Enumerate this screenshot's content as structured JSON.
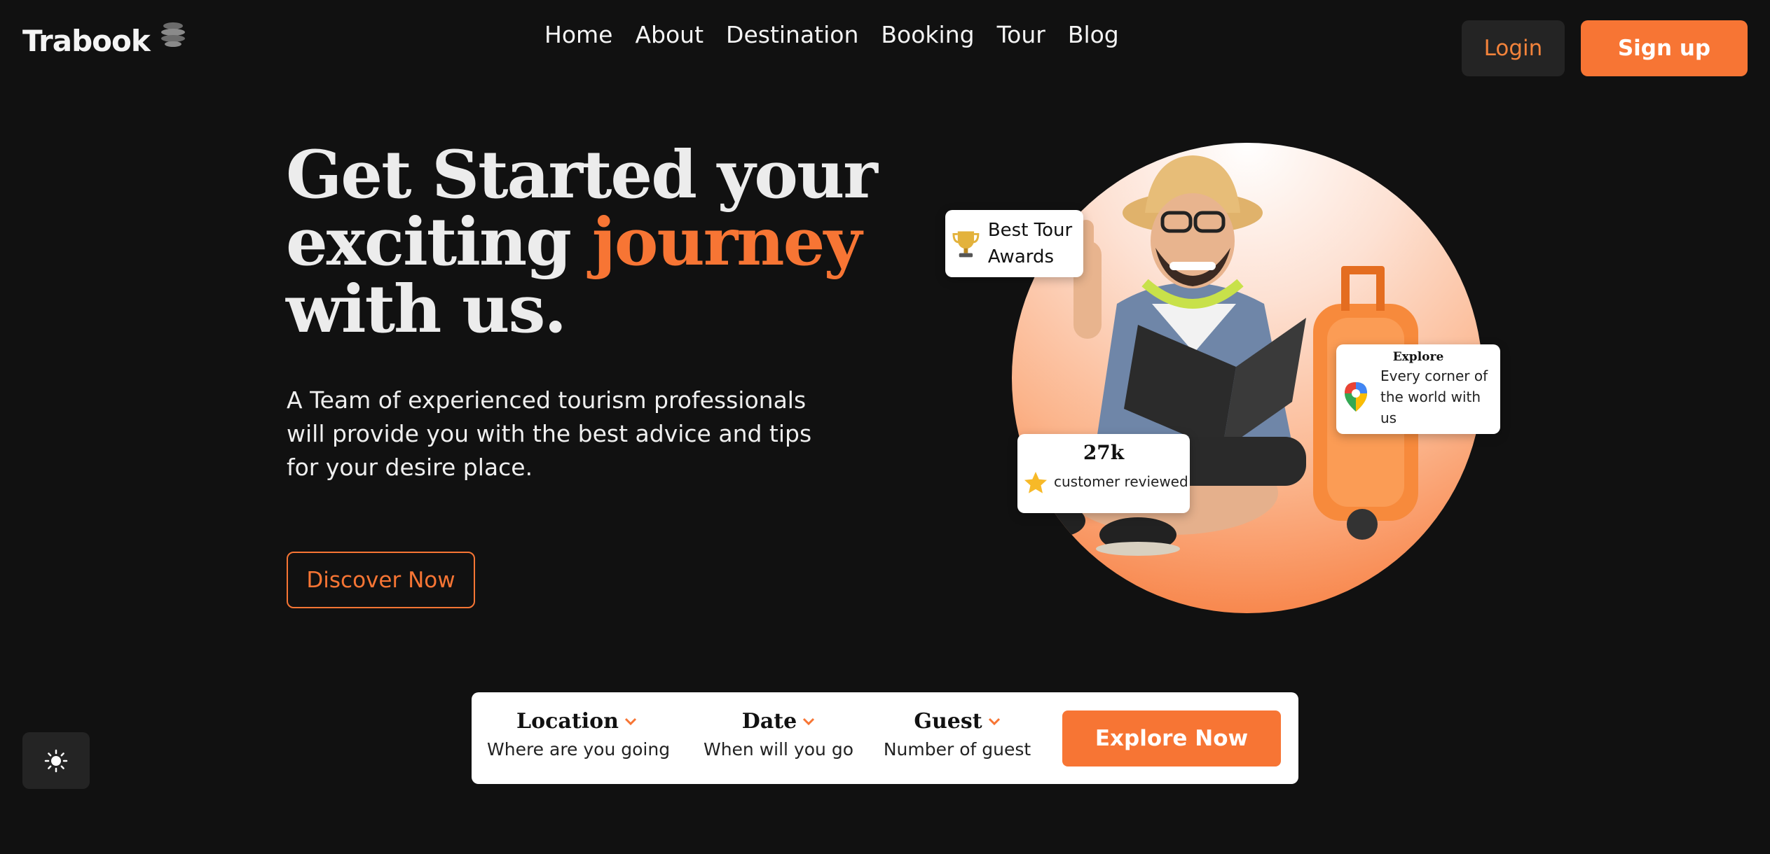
{
  "brand": {
    "name": "Trabook"
  },
  "nav": {
    "items": [
      {
        "label": "Home"
      },
      {
        "label": "About"
      },
      {
        "label": "Destination"
      },
      {
        "label": "Booking"
      },
      {
        "label": "Tour"
      },
      {
        "label": "Blog"
      }
    ]
  },
  "auth": {
    "login_label": "Login",
    "signup_label": "Sign up"
  },
  "hero": {
    "title_line1": "Get Started your",
    "title_line2_prefix": "exciting ",
    "title_accent": "journey",
    "title_line3": "with us.",
    "description": "A Team of experienced tourism professionals will provide you with the best advice and tips for your desire place.",
    "cta_label": "Discover Now"
  },
  "badges": {
    "award": {
      "label": "Best Tour Awards",
      "icon": "trophy-icon"
    },
    "explore": {
      "title": "Explore",
      "description": "Every corner of the world with us",
      "icon": "map-pin-icon"
    },
    "reviews": {
      "count": "27k",
      "description": "customer reviewed",
      "icon": "star-icon"
    }
  },
  "search": {
    "location": {
      "label": "Location",
      "hint": "Where are you going"
    },
    "date": {
      "label": "Date",
      "hint": "When will you go"
    },
    "guest": {
      "label": "Guest",
      "hint": "Number of guest"
    },
    "submit_label": "Explore Now"
  },
  "theme_toggle": {
    "icon": "sun-icon"
  },
  "colors": {
    "accent": "#f77534",
    "background": "#111111",
    "surface": "#242424",
    "text": "#f2f2f2"
  }
}
